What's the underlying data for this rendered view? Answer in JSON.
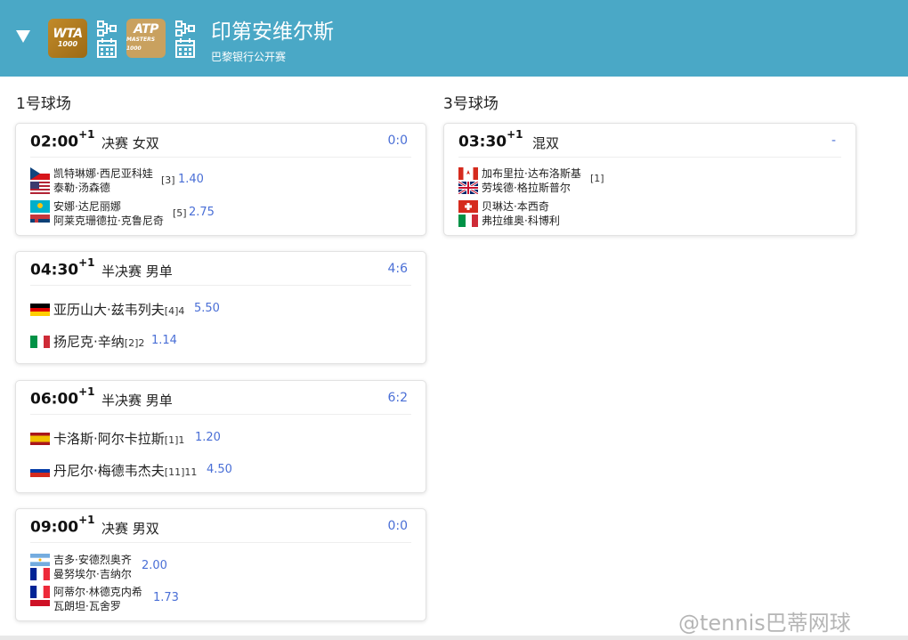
{
  "header": {
    "tournament_name": "印第安维尔斯",
    "sponsor_name": "巴黎银行公开赛",
    "wta_logo": {
      "text": "WTA",
      "sub": "1000"
    },
    "atp_logo": {
      "text": "ATP",
      "sub": "MASTERS 1000"
    },
    "icons": [
      "collapse-caret-icon",
      "bracket-icon",
      "calendar-icon"
    ],
    "colors": {
      "header_bg": "#4aa8c6",
      "link": "#4a6fd6"
    }
  },
  "courts": [
    {
      "title": "1号球场",
      "matches": [
        {
          "time": "02:00",
          "day_offset": "+1",
          "round": "决赛 女双",
          "score": "0:0",
          "teams": [
            {
              "players": [
                {
                  "name": "凯特琳娜·西尼亚科娃",
                  "flag": "CZ"
                },
                {
                  "name": "泰勒·汤森德",
                  "flag": "US"
                }
              ],
              "seed": "[3]",
              "odds": "1.40"
            },
            {
              "players": [
                {
                  "name": "安娜·达尼丽娜",
                  "flag": "KZ"
                },
                {
                  "name": "阿莱克珊德拉·克鲁尼奇",
                  "flag": "RS"
                }
              ],
              "seed": "[5]",
              "odds": "2.75"
            }
          ]
        },
        {
          "time": "04:30",
          "day_offset": "+1",
          "round": "半决赛 男单",
          "score": "4:6",
          "teams": [
            {
              "players": [
                {
                  "name": "亚历山大·兹韦列夫",
                  "flag": "DE"
                }
              ],
              "seed": "[4]4",
              "odds": "5.50"
            },
            {
              "players": [
                {
                  "name": "扬尼克·辛纳",
                  "flag": "IT"
                }
              ],
              "seed": "[2]2",
              "odds": "1.14"
            }
          ]
        },
        {
          "time": "06:00",
          "day_offset": "+1",
          "round": "半决赛 男单",
          "score": "6:2",
          "teams": [
            {
              "players": [
                {
                  "name": "卡洛斯·阿尔卡拉斯",
                  "flag": "ES"
                }
              ],
              "seed": "[1]1",
              "odds": "1.20"
            },
            {
              "players": [
                {
                  "name": "丹尼尔·梅德韦杰夫",
                  "flag": "RU"
                }
              ],
              "seed": "[11]11",
              "odds": "4.50"
            }
          ]
        },
        {
          "time": "09:00",
          "day_offset": "+1",
          "round": "决赛 男双",
          "score": "0:0",
          "teams": [
            {
              "players": [
                {
                  "name": "吉多·安德烈奥齐",
                  "flag": "AR"
                },
                {
                  "name": "曼努埃尔·吉纳尔",
                  "flag": "FR"
                }
              ],
              "seed": "",
              "odds": "2.00"
            },
            {
              "players": [
                {
                  "name": "阿蒂尔·林德克内希",
                  "flag": "FR"
                },
                {
                  "name": "瓦朗坦·瓦舍罗",
                  "flag": "MC"
                }
              ],
              "seed": "",
              "odds": "1.73"
            }
          ]
        }
      ]
    },
    {
      "title": "3号球场",
      "matches": [
        {
          "time": "03:30",
          "day_offset": "+1",
          "round": "混双",
          "score": "-",
          "teams": [
            {
              "players": [
                {
                  "name": "加布里拉·达布洛斯基",
                  "flag": "CA"
                },
                {
                  "name": "劳埃德·格拉斯普尔",
                  "flag": "GB"
                }
              ],
              "seed": "[1]",
              "odds": ""
            },
            {
              "players": [
                {
                  "name": "贝琳达·本西奇",
                  "flag": "CH"
                },
                {
                  "name": "弗拉维奥·科博利",
                  "flag": "IT"
                }
              ],
              "seed": "",
              "odds": ""
            }
          ]
        }
      ]
    }
  ],
  "watermark": "@tennis巴蒂网球"
}
